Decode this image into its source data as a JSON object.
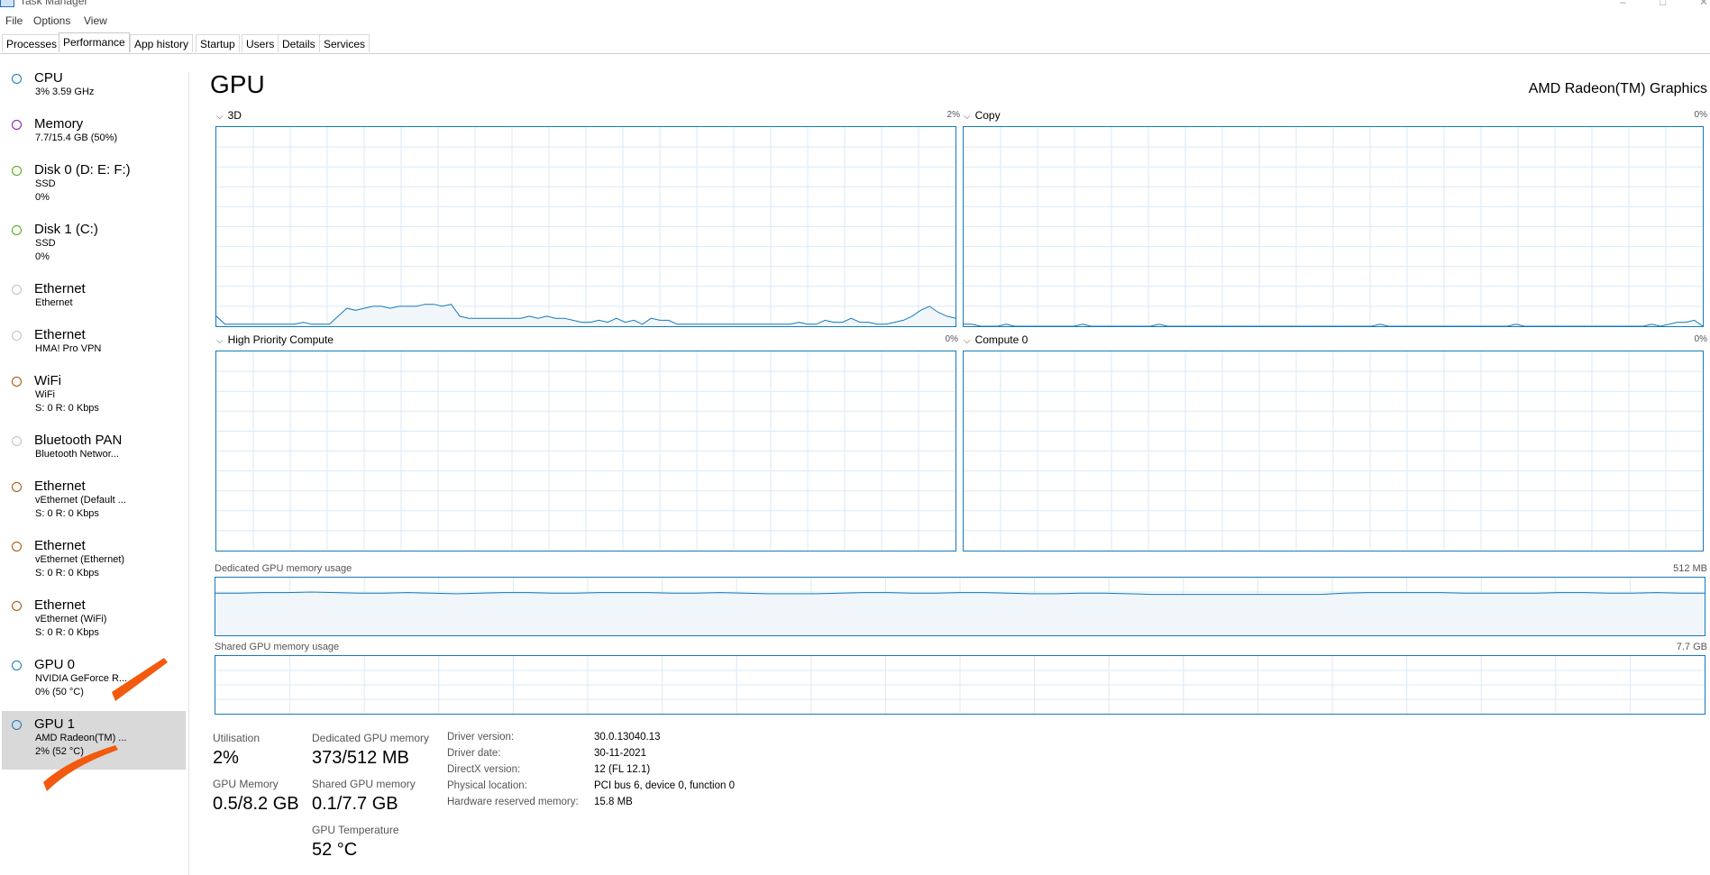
{
  "window": {
    "title": "Task Manager",
    "minimize": "–",
    "maximize": "□",
    "close": "✕"
  },
  "menu": [
    "File",
    "Options",
    "View"
  ],
  "tabs": [
    "Processes",
    "Performance",
    "App history",
    "Startup",
    "Users",
    "Details",
    "Services"
  ],
  "sidebar": [
    {
      "name": "CPU",
      "sub1": "3%  3.59 GHz",
      "sub2": "",
      "color": "#1779ba"
    },
    {
      "name": "Memory",
      "sub1": "7.7/15.4 GB (50%)",
      "sub2": "",
      "color": "#8b12ae"
    },
    {
      "name": "Disk 0 (D: E: F:)",
      "sub1": "SSD",
      "sub2": "0%",
      "color": "#4da60c"
    },
    {
      "name": "Disk 1 (C:)",
      "sub1": "SSD",
      "sub2": "0%",
      "color": "#4da60c"
    },
    {
      "name": "Ethernet",
      "sub1": "Ethernet",
      "sub2": "",
      "color": "#c0c0c0"
    },
    {
      "name": "Ethernet",
      "sub1": "HMA! Pro VPN",
      "sub2": "",
      "color": "#c0c0c0"
    },
    {
      "name": "WiFi",
      "sub1": "WiFi",
      "sub2": "S: 0  R: 0 Kbps",
      "color": "#a74f01"
    },
    {
      "name": "Bluetooth PAN",
      "sub1": "Bluetooth Networ...",
      "sub2": "",
      "color": "#c0c0c0"
    },
    {
      "name": "Ethernet",
      "sub1": "vEthernet (Default ...",
      "sub2": "S: 0  R: 0 Kbps",
      "color": "#a74f01"
    },
    {
      "name": "Ethernet",
      "sub1": "vEthernet (Ethernet)",
      "sub2": "S: 0  R: 0 Kbps",
      "color": "#a74f01"
    },
    {
      "name": "Ethernet",
      "sub1": "vEthernet (WiFi)",
      "sub2": "S: 0  R: 0 Kbps",
      "color": "#a74f01"
    },
    {
      "name": "GPU 0",
      "sub1": "NVIDIA GeForce R...",
      "sub2": "0%  (50 °C)",
      "color": "#1779ba"
    },
    {
      "name": "GPU 1",
      "sub1": "AMD Radeon(TM) ...",
      "sub2": "2%  (52 °C)",
      "color": "#1779ba",
      "selected": true
    }
  ],
  "main": {
    "title": "GPU",
    "model": "AMD Radeon(TM) Graphics",
    "engines": [
      {
        "label": "3D",
        "pct": "2%",
        "values": [
          0.05,
          0.01,
          0.01,
          0.01,
          0.01,
          0.01,
          0.01,
          0.01,
          0.01,
          0.01,
          0.02,
          0.01,
          0.01,
          0.01,
          0.05,
          0.09,
          0.08,
          0.09,
          0.1,
          0.1,
          0.09,
          0.1,
          0.1,
          0.1,
          0.11,
          0.11,
          0.1,
          0.11,
          0.05,
          0.04,
          0.04,
          0.04,
          0.04,
          0.04,
          0.04,
          0.04,
          0.05,
          0.04,
          0.05,
          0.04,
          0.04,
          0.03,
          0.02,
          0.02,
          0.03,
          0.02,
          0.04,
          0.02,
          0.03,
          0.01,
          0.04,
          0.03,
          0.03,
          0.01,
          0.01,
          0.01,
          0.01,
          0.01,
          0.01,
          0.01,
          0.01,
          0.01,
          0.01,
          0.01,
          0.01,
          0.01,
          0.01,
          0.02,
          0.01,
          0.01,
          0.03,
          0.02,
          0.02,
          0.04,
          0.02,
          0.02,
          0.01,
          0.01,
          0.02,
          0.03,
          0.05,
          0.08,
          0.1,
          0.07,
          0.05,
          0.04
        ]
      },
      {
        "label": "Copy",
        "pct": "0%",
        "values": [
          0.01,
          0.01,
          0.0,
          0.0,
          0.0,
          0.01,
          0.0,
          0.0,
          0.0,
          0.0,
          0.0,
          0.0,
          0.0,
          0.0,
          0.01,
          0.0,
          0.0,
          0.0,
          0.0,
          0.0,
          0.0,
          0.0,
          0.0,
          0.01,
          0.0,
          0.0,
          0.0,
          0.0,
          0.0,
          0.0,
          0.0,
          0.0,
          0.0,
          0.0,
          0.0,
          0.0,
          0.0,
          0.0,
          0.0,
          0.0,
          0.0,
          0.0,
          0.0,
          0.0,
          0.0,
          0.0,
          0.0,
          0.0,
          0.0,
          0.01,
          0.0,
          0.0,
          0.0,
          0.0,
          0.0,
          0.0,
          0.0,
          0.0,
          0.0,
          0.0,
          0.0,
          0.0,
          0.0,
          0.0,
          0.0,
          0.01,
          0.0,
          0.0,
          0.0,
          0.0,
          0.0,
          0.0,
          0.0,
          0.0,
          0.0,
          0.0,
          0.0,
          0.0,
          0.0,
          0.0,
          0.0,
          0.01,
          0.0,
          0.01,
          0.02,
          0.02,
          0.03,
          0.0
        ]
      },
      {
        "label": "High Priority Compute",
        "pct": "0%",
        "values": []
      },
      {
        "label": "Compute 0",
        "pct": "0%",
        "values": []
      }
    ],
    "dedicated": {
      "label": "Dedicated GPU memory usage",
      "max": "512 MB",
      "values": [
        0.73,
        0.73,
        0.74,
        0.74,
        0.75,
        0.74,
        0.73,
        0.73,
        0.74,
        0.73,
        0.72,
        0.73,
        0.74,
        0.74,
        0.73,
        0.73,
        0.74,
        0.74,
        0.74,
        0.73,
        0.73,
        0.74,
        0.73,
        0.72,
        0.72,
        0.72,
        0.73,
        0.74,
        0.74,
        0.73,
        0.73,
        0.74,
        0.74,
        0.73,
        0.72,
        0.72,
        0.73,
        0.73,
        0.72,
        0.71,
        0.71,
        0.71,
        0.71,
        0.71,
        0.71,
        0.71,
        0.71,
        0.73,
        0.74,
        0.74,
        0.74,
        0.74,
        0.73,
        0.73,
        0.73,
        0.73,
        0.74,
        0.74,
        0.73,
        0.73,
        0.74,
        0.73,
        0.73
      ]
    },
    "shared": {
      "label": "Shared GPU memory usage",
      "max": "7.7 GB",
      "values": []
    },
    "stats": {
      "util_label": "Utilisation",
      "util_value": "2%",
      "ded_label": "Dedicated GPU memory",
      "ded_value": "373/512 MB",
      "gpumem_label": "GPU Memory",
      "gpumem_value": "0.5/8.2 GB",
      "shared_label": "Shared GPU memory",
      "shared_value": "0.1/7.7 GB",
      "temp_label": "GPU Temperature",
      "temp_value": "52 °C"
    },
    "info": [
      {
        "key": "Driver version:",
        "value": "30.0.13040.13"
      },
      {
        "key": "Driver date:",
        "value": "30-11-2021"
      },
      {
        "key": "DirectX version:",
        "value": "12 (FL 12.1)"
      },
      {
        "key": "Physical location:",
        "value": "PCI bus 6, device 0, function 0"
      },
      {
        "key": "Hardware reserved memory:",
        "value": "15.8 MB"
      }
    ]
  },
  "colors": {
    "graph_border": "#1779ba",
    "graph_grid": "#d9eaf7",
    "graph_fill": "#f1f6fa",
    "annotation": "#f25a0f"
  }
}
